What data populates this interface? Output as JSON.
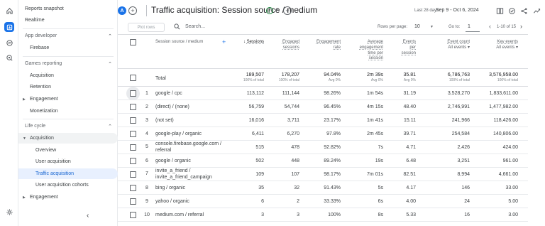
{
  "rail": {
    "icons": [
      "home-icon",
      "reports-icon",
      "explore-icon",
      "advertising-icon",
      "settings-icon"
    ]
  },
  "nav": {
    "reports_snapshot": "Reports snapshot",
    "realtime": "Realtime",
    "app_developer": "App developer",
    "firebase": "Firebase",
    "games_reporting": "Games reporting",
    "acquisition_g": "Acquisition",
    "retention": "Retention",
    "engagement_g": "Engagement",
    "monetization": "Monetization",
    "life_cycle": "Life cycle",
    "acquisition": "Acquisition",
    "overview": "Overview",
    "user_acquisition": "User acquisition",
    "traffic_acquisition": "Traffic acquisition",
    "user_acquisition_cohorts": "User acquisition cohorts",
    "engagement": "Engagement"
  },
  "header": {
    "avatar_letter": "A",
    "title": "Traffic acquisition: Session source / medium",
    "date_label": "Last 28 days",
    "date_range": "Sep 9 - Oct 6, 2024"
  },
  "toolbar": {
    "plot_rows": "Plot rows",
    "search_placeholder": "Search...",
    "rows_per_page_label": "Rows per page:",
    "rows_per_page": "10",
    "goto_label": "Go to:",
    "goto_value": "1",
    "page_range": "1-10 of 15"
  },
  "table": {
    "dimension_header": "Session source / medium",
    "columns": [
      {
        "l1": "Sessions",
        "l2": "",
        "l3": "",
        "l4": ""
      },
      {
        "l1": "Engaged",
        "l2": "sessions",
        "l3": "",
        "l4": ""
      },
      {
        "l1": "Engagement",
        "l2": "rate",
        "l3": "",
        "l4": ""
      },
      {
        "l1": "Average",
        "l2": "engagement",
        "l3": "time per",
        "l4": "session"
      },
      {
        "l1": "Events",
        "l2": "per",
        "l3": "session",
        "l4": ""
      },
      {
        "l1": "Event count",
        "l2": "All events ▾",
        "l3": "",
        "l4": ""
      },
      {
        "l1": "Key events",
        "l2": "All events ▾",
        "l3": "",
        "l4": ""
      }
    ],
    "sort_arrow": "↓",
    "total": {
      "label": "Total",
      "values": [
        "189,507",
        "178,207",
        "94.04%",
        "2m 39s",
        "35.81",
        "6,786,763",
        "3,576,958.00"
      ],
      "subs": [
        "100% of total",
        "100% of total",
        "Avg 0%",
        "Avg 0%",
        "Avg 0%",
        "100% of total",
        "100% of total"
      ]
    },
    "rows": [
      {
        "i": "1",
        "src1": "google / cpc",
        "src2": "",
        "v": [
          "113,112",
          "111,144",
          "98.26%",
          "1m 54s",
          "31.19",
          "3,528,270",
          "1,833,611.00"
        ]
      },
      {
        "i": "2",
        "src1": "(direct) / (none)",
        "src2": "",
        "v": [
          "56,759",
          "54,744",
          "96.45%",
          "4m 15s",
          "48.40",
          "2,746,991",
          "1,477,982.00"
        ]
      },
      {
        "i": "3",
        "src1": "(not set)",
        "src2": "",
        "v": [
          "16,016",
          "3,711",
          "23.17%",
          "1m 41s",
          "15.11",
          "241,966",
          "118,426.00"
        ]
      },
      {
        "i": "4",
        "src1": "google-play / organic",
        "src2": "",
        "v": [
          "6,411",
          "6,270",
          "97.8%",
          "2m 45s",
          "39.71",
          "254,584",
          "140,806.00"
        ]
      },
      {
        "i": "5",
        "src1": "console.firebase.google.com /",
        "src2": "referral",
        "v": [
          "515",
          "478",
          "92.82%",
          "7s",
          "4.71",
          "2,426",
          "424.00"
        ]
      },
      {
        "i": "6",
        "src1": "google / organic",
        "src2": "",
        "v": [
          "502",
          "448",
          "89.24%",
          "19s",
          "6.48",
          "3,251",
          "961.00"
        ]
      },
      {
        "i": "7",
        "src1": "invite_a_friend /",
        "src2": "invite_a_friend_campaign",
        "v": [
          "109",
          "107",
          "98.17%",
          "7m 01s",
          "82.51",
          "8,994",
          "4,661.00"
        ]
      },
      {
        "i": "8",
        "src1": "bing / organic",
        "src2": "",
        "v": [
          "35",
          "32",
          "91.43%",
          "5s",
          "4.17",
          "146",
          "33.00"
        ]
      },
      {
        "i": "9",
        "src1": "yahoo / organic",
        "src2": "",
        "v": [
          "6",
          "2",
          "33.33%",
          "6s",
          "4.00",
          "24",
          "5.00"
        ]
      },
      {
        "i": "10",
        "src1": "medium.com / referral",
        "src2": "",
        "v": [
          "3",
          "3",
          "100%",
          "8s",
          "5.33",
          "16",
          "3.00"
        ]
      }
    ]
  }
}
